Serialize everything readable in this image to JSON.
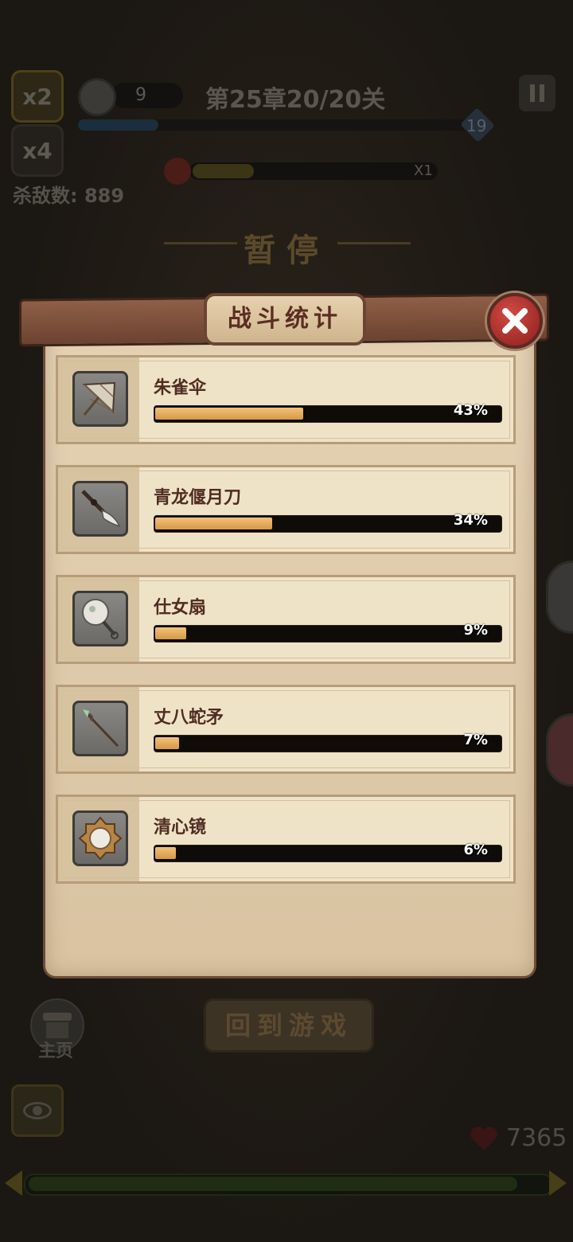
{
  "hud": {
    "speed_x2": "x2",
    "speed_x4": "x4",
    "gem_count": "9",
    "chapter": "第25章20/20关",
    "wave_number": "19",
    "wave_progress": 0.2,
    "rage_multiplier": "X1",
    "rage_progress": 0.25,
    "kills_label": "杀敌数:",
    "kills_value": "889",
    "paused_label": "暂停",
    "home_label": "主页",
    "hp_value": "7365",
    "xp_progress": 0.93
  },
  "dialog": {
    "title": "战斗统计",
    "close_icon": "close-icon",
    "items": [
      {
        "name": "朱雀伞",
        "percent": 43,
        "percent_label": "43%",
        "icon": "umbrella-icon"
      },
      {
        "name": "青龙偃月刀",
        "percent": 34,
        "percent_label": "34%",
        "icon": "glaive-icon"
      },
      {
        "name": "仕女扇",
        "percent": 9,
        "percent_label": "9%",
        "icon": "fan-icon"
      },
      {
        "name": "丈八蛇矛",
        "percent": 7,
        "percent_label": "7%",
        "icon": "spear-icon"
      },
      {
        "name": "清心镜",
        "percent": 6,
        "percent_label": "6%",
        "icon": "mirror-icon"
      }
    ]
  },
  "return_button": "回到游戏",
  "colors": {
    "bar_fill": "#e4ac5c",
    "close_red": "#c23a35",
    "parchment": "#e4d2b4",
    "title_text": "#5b2e22"
  }
}
